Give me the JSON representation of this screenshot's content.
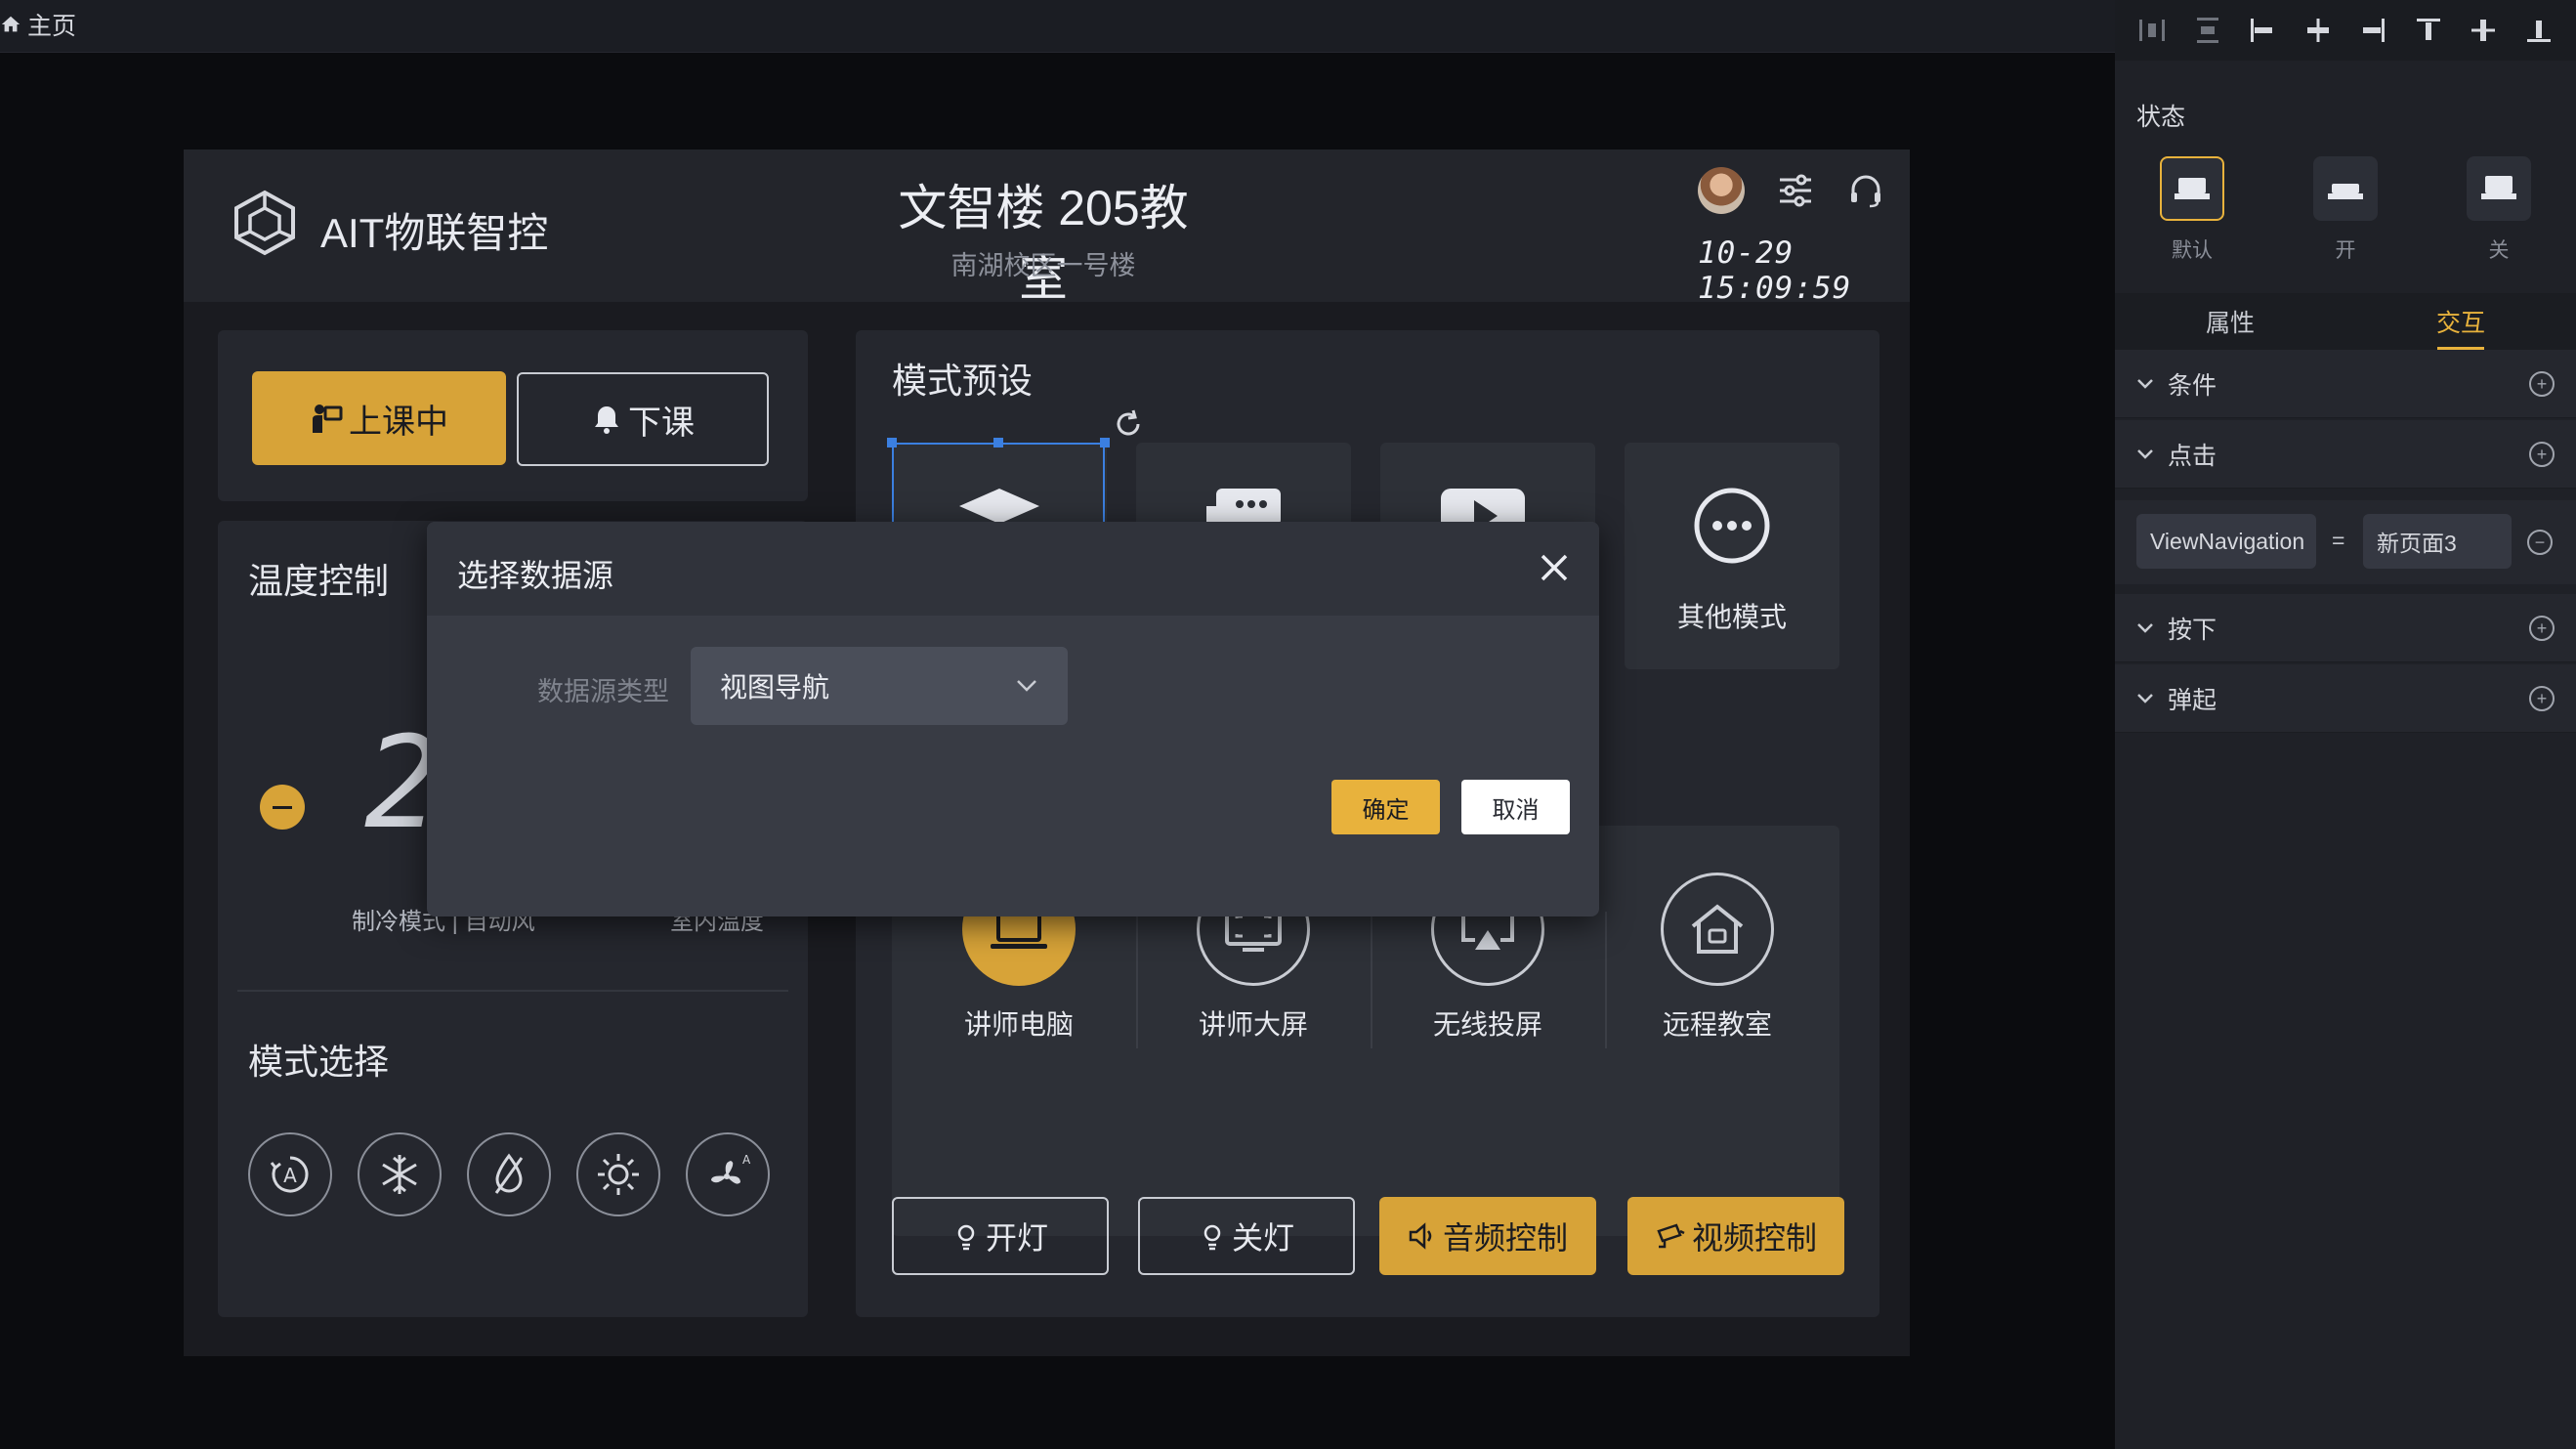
{
  "topbar": {
    "home_label": "主页"
  },
  "canvas": {
    "brand": "AIT物联智控",
    "title": "文智楼 205教室",
    "subtitle": "南湖校区一号楼",
    "datetime": "10-29 15:09:59",
    "class_buttons": {
      "in_class": "上课中",
      "dismiss": "下课"
    },
    "temperature": {
      "heading": "温度控制",
      "display_digit": "2",
      "mode_line": "制冷模式 | 自动风",
      "room_label": "室内温度"
    },
    "mode_select": {
      "heading": "模式选择",
      "icons": [
        "auto-mode-icon",
        "snowflake-icon",
        "dehumidify-icon",
        "sun-icon",
        "fan-auto-icon"
      ]
    },
    "mode_preset": {
      "heading": "模式预设",
      "other_label": "其他模式"
    },
    "sources": [
      {
        "label": "讲师电脑",
        "icon": "laptop-icon",
        "active": true
      },
      {
        "label": "讲师大屏",
        "icon": "screen-icon",
        "active": false
      },
      {
        "label": "无线投屏",
        "icon": "cast-icon",
        "active": false
      },
      {
        "label": "远程教室",
        "icon": "home-icon",
        "active": false
      }
    ],
    "bottom_buttons": {
      "light_on": "开灯",
      "light_off": "关灯",
      "audio": "音频控制",
      "video": "视频控制"
    }
  },
  "modal": {
    "title": "选择数据源",
    "field_label": "数据源类型",
    "selected_value": "视图导航",
    "confirm": "确定",
    "cancel": "取消"
  },
  "right_panel": {
    "state_title": "状态",
    "states": [
      "默认",
      "开",
      "关"
    ],
    "tabs": [
      "属性",
      "交互"
    ],
    "active_tab": "交互",
    "sections": {
      "condition": "条件",
      "click": "点击",
      "press": "按下",
      "release": "弹起"
    },
    "nav_binding": {
      "key": "ViewNavigation",
      "equals": "=",
      "value": "新页面3"
    }
  },
  "colors": {
    "accent": "#d7a338",
    "selection": "#3b7fe0"
  }
}
